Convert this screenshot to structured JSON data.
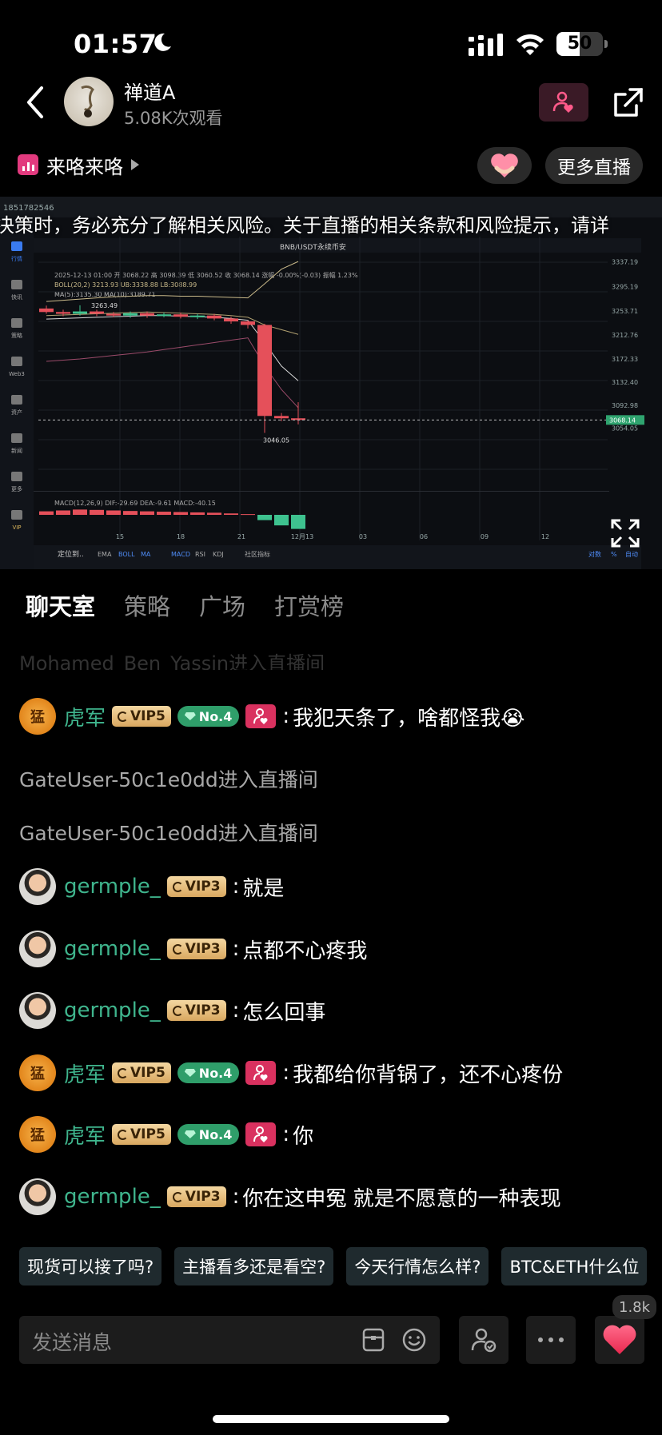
{
  "status_bar": {
    "time": "01:57",
    "battery": "50",
    "battery_level": 0.5
  },
  "header": {
    "host_name": "禅道A",
    "viewers": "5.08K次观看",
    "tag_label": "来咯来咯",
    "more_live": "更多直播"
  },
  "video": {
    "marquee": "决策时，务必充分了解相关风险。关于直播的相关条款和风险提示，请详",
    "chart_texts": {
      "window_id": "1851782546",
      "pair_title": "BNB/USDT永续币安",
      "date_line": "2025-12-13 01:00 开 3068.22 高 3098.39 低 3060.52 收 3068.14 涨幅 -0.00%(-0.03) 振幅 1.23%",
      "boll_line": "BOLL(20,2) 3213.93 UB:3338.88 LB:3088.99",
      "ma_line": "MA(5):3135.30 MA(10):3189.71",
      "high_label": "3263.49",
      "low_label": "3046.05",
      "price_tag": "3068.14",
      "macd_line": "MACD(12,26,9) DIF:-29.69 DEA:-9.61 MACD:-40.15",
      "toolbar_items": [
        "EMA",
        "BOLL",
        "MA",
        "MACD",
        "RSI",
        "KDJ",
        "社区指标"
      ],
      "bottom_left": "定位到..",
      "bottom_right": [
        "对数",
        "%",
        "自动"
      ],
      "side_labels": [
        "行情",
        "快讯",
        "策略",
        "Web3",
        "资产",
        "新闻",
        "更多",
        "VIP"
      ]
    },
    "chart_data": {
      "type": "candlestick",
      "price_axis_ticks": [
        "3337.19",
        "3295.19",
        "3253.71",
        "3212.76",
        "3172.33",
        "3132.40",
        "3092.98",
        "3054.05"
      ],
      "time_axis_ticks": [
        "15",
        "18",
        "21",
        "12月13",
        "03",
        "06",
        "09",
        "12"
      ],
      "ylim": [
        3040,
        3345
      ],
      "candles": [
        {
          "open": 3258,
          "close": 3252,
          "high": 3263,
          "low": 3249
        },
        {
          "open": 3252,
          "close": 3249,
          "high": 3256,
          "low": 3245
        },
        {
          "open": 3249,
          "close": 3253,
          "high": 3263.49,
          "low": 3246
        },
        {
          "open": 3253,
          "close": 3249,
          "high": 3256,
          "low": 3245
        },
        {
          "open": 3249,
          "close": 3246,
          "high": 3252,
          "low": 3243
        },
        {
          "open": 3246,
          "close": 3250,
          "high": 3253,
          "low": 3242
        },
        {
          "open": 3250,
          "close": 3246,
          "high": 3253,
          "low": 3242
        },
        {
          "open": 3246,
          "close": 3248,
          "high": 3251,
          "low": 3243
        },
        {
          "open": 3248,
          "close": 3244,
          "high": 3251,
          "low": 3241
        },
        {
          "open": 3244,
          "close": 3246,
          "high": 3249,
          "low": 3240
        },
        {
          "open": 3246,
          "close": 3241,
          "high": 3249,
          "low": 3238
        },
        {
          "open": 3241,
          "close": 3236,
          "high": 3244,
          "low": 3232
        },
        {
          "open": 3236,
          "close": 3230,
          "high": 3238,
          "low": 3224
        },
        {
          "open": 3230,
          "close": 3075,
          "high": 3232,
          "low": 3046.05
        },
        {
          "open": 3075,
          "close": 3071,
          "high": 3080,
          "low": 3066
        },
        {
          "open": 3071,
          "close": 3068.14,
          "high": 3098.39,
          "low": 3060.52
        }
      ]
    }
  },
  "tabs": [
    "聊天室",
    "策略",
    "广场",
    "打赏榜"
  ],
  "chat": {
    "faded_line": "Mohamed_Ben_Yassin进入直播间",
    "messages": [
      {
        "kind": "user",
        "avatar": "tiger",
        "avatar_text": "猛",
        "user": "虎军",
        "vip": "VIP5",
        "rank": "No.4",
        "fan": true,
        "text": "我犯天条了，啥都怪我😭"
      },
      {
        "kind": "system",
        "text": "GateUser-50c1e0dd进入直播间"
      },
      {
        "kind": "system",
        "text": "GateUser-50c1e0dd进入直播间"
      },
      {
        "kind": "user",
        "avatar": "man",
        "user": "germple_",
        "vip": "VIP3",
        "text": "就是"
      },
      {
        "kind": "user",
        "avatar": "man",
        "user": "germple_",
        "vip": "VIP3",
        "text": "点都不心疼我"
      },
      {
        "kind": "user",
        "avatar": "man",
        "user": "germple_",
        "vip": "VIP3",
        "text": "怎么回事"
      },
      {
        "kind": "user",
        "avatar": "tiger",
        "avatar_text": "猛",
        "user": "虎军",
        "vip": "VIP5",
        "rank": "No.4",
        "fan": true,
        "text": "我都给你背锅了，还不心疼份"
      },
      {
        "kind": "user",
        "avatar": "tiger",
        "avatar_text": "猛",
        "user": "虎军",
        "vip": "VIP5",
        "rank": "No.4",
        "fan": true,
        "text": "你"
      },
      {
        "kind": "user",
        "avatar": "man",
        "user": "germple_",
        "vip": "VIP3",
        "text": "你在这申冤 就是不愿意的一种表现"
      }
    ]
  },
  "quick_replies": [
    "现货可以接了吗?",
    "主播看多还是看空?",
    "今天行情怎么样?",
    "BTC&ETH什么位"
  ],
  "input": {
    "placeholder": "发送消息",
    "like_count": "1.8k"
  },
  "colors": {
    "accent_pink": "#e23a7e",
    "username_green": "#3fb58d",
    "candle_up": "#3ec28f",
    "candle_down": "#e5505a"
  }
}
